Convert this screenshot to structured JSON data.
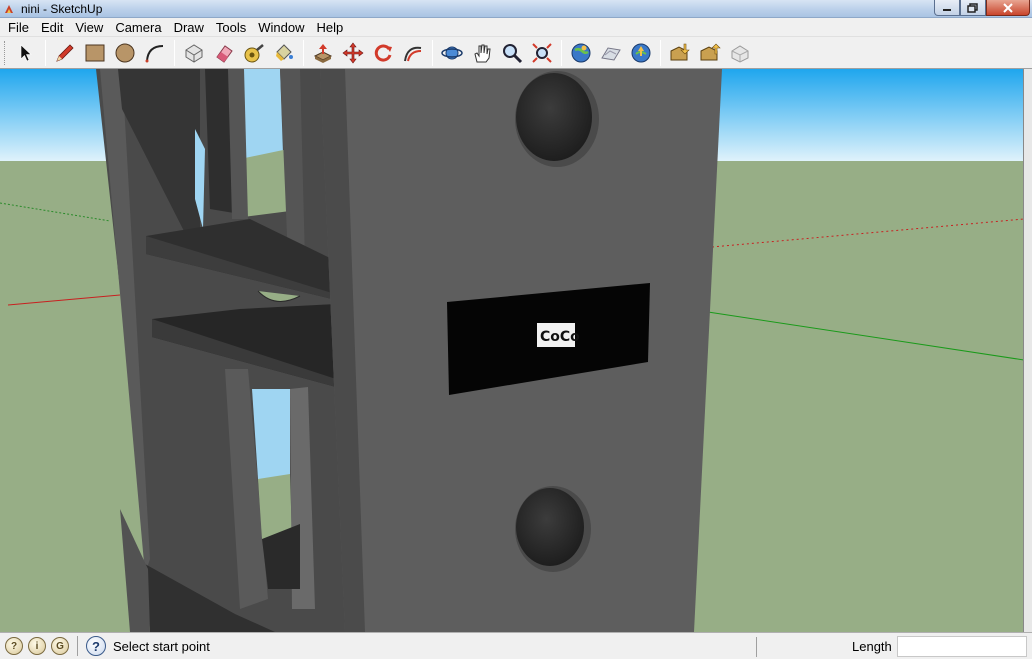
{
  "window": {
    "title": "nini - SketchUp",
    "controls": [
      "minimize-icon",
      "maximize-icon",
      "close-icon"
    ]
  },
  "menu": {
    "items": [
      "File",
      "Edit",
      "View",
      "Camera",
      "Draw",
      "Tools",
      "Window",
      "Help"
    ]
  },
  "toolbar": {
    "tools": [
      {
        "name": "select-tool",
        "icon": "arrow-cursor-icon"
      },
      {
        "name": "pencil-tool",
        "icon": "pencil-icon"
      },
      {
        "name": "rectangle-tool",
        "icon": "rectangle-icon"
      },
      {
        "name": "circle-tool",
        "icon": "circle-icon"
      },
      {
        "name": "arc-tool",
        "icon": "arc-icon"
      },
      {
        "name": "make-component-tool",
        "icon": "component-icon"
      },
      {
        "name": "eraser-tool",
        "icon": "eraser-icon"
      },
      {
        "name": "tape-measure-tool",
        "icon": "tape-measure-icon"
      },
      {
        "name": "paint-bucket-tool",
        "icon": "paint-bucket-icon"
      },
      {
        "name": "push-pull-tool",
        "icon": "push-pull-icon"
      },
      {
        "name": "move-tool",
        "icon": "move-icon"
      },
      {
        "name": "rotate-tool",
        "icon": "rotate-icon"
      },
      {
        "name": "follow-me-tool",
        "icon": "follow-me-icon"
      },
      {
        "name": "orbit-tool",
        "icon": "orbit-icon"
      },
      {
        "name": "pan-tool",
        "icon": "hand-icon"
      },
      {
        "name": "zoom-tool",
        "icon": "magnifier-icon"
      },
      {
        "name": "zoom-extents-tool",
        "icon": "zoom-extents-icon"
      },
      {
        "name": "add-location-tool",
        "icon": "globe-location-icon"
      },
      {
        "name": "toggle-terrain-tool",
        "icon": "terrain-icon"
      },
      {
        "name": "preview-google-earth-tool",
        "icon": "google-earth-icon"
      },
      {
        "name": "get-models-tool",
        "icon": "warehouse-get-icon"
      },
      {
        "name": "share-model-tool",
        "icon": "warehouse-share-icon"
      },
      {
        "name": "share-component-tool",
        "icon": "share-component-icon"
      }
    ]
  },
  "scene": {
    "sky_color": "#72c9f4",
    "ground_color": "#97ae86",
    "model_color": "#5e5e5e",
    "label_text": "CoCo"
  },
  "status": {
    "icons": [
      "geo-location-icon",
      "credits-icon",
      "google-sign-in-icon"
    ],
    "help_icon": "question-icon",
    "message": "Select start point",
    "measurement_label": "Length",
    "measurement_value": ""
  }
}
